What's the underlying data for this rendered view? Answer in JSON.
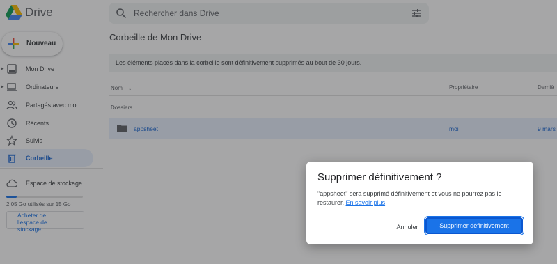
{
  "app": {
    "brand": "Drive"
  },
  "search": {
    "placeholder": "Rechercher dans Drive"
  },
  "sidebar": {
    "new_label": "Nouveau",
    "items": [
      {
        "label": "Mon Drive",
        "icon": "drive-icon"
      },
      {
        "label": "Ordinateurs",
        "icon": "computer-icon"
      },
      {
        "label": "Partagés avec moi",
        "icon": "people-icon"
      },
      {
        "label": "Récents",
        "icon": "clock-icon"
      },
      {
        "label": "Suivis",
        "icon": "star-icon"
      },
      {
        "label": "Corbeille",
        "icon": "trash-icon",
        "active": true
      }
    ],
    "storage_label": "Espace de stockage",
    "storage_used": "2,05 Go utilisés sur 15 Go",
    "storage_fraction": 0.137,
    "buy_label": "Acheter de l'espace de stockage"
  },
  "main": {
    "breadcrumb": "Corbeille de Mon Drive",
    "info_banner": "Les éléments placés dans la corbeille sont définitivement supprimés au bout de 30 jours.",
    "columns": {
      "name": "Nom",
      "owner": "Propriétaire",
      "modified": "Derniè"
    },
    "section_label": "Dossiers",
    "rows": [
      {
        "name": "appsheet",
        "owner": "moi",
        "date": "9 mars"
      }
    ]
  },
  "dialog": {
    "title": "Supprimer définitivement ?",
    "message": "\"appsheet\" sera supprimé définitivement et vous ne pourrez pas le restaurer.",
    "link": "En savoir plus",
    "cancel_label": "Annuler",
    "confirm_label": "Supprimer définitivement"
  },
  "colors": {
    "accent": "#1a73e8",
    "selected_bg": "#e8f0fe",
    "scrim": "rgba(32,33,36,0.40)"
  }
}
